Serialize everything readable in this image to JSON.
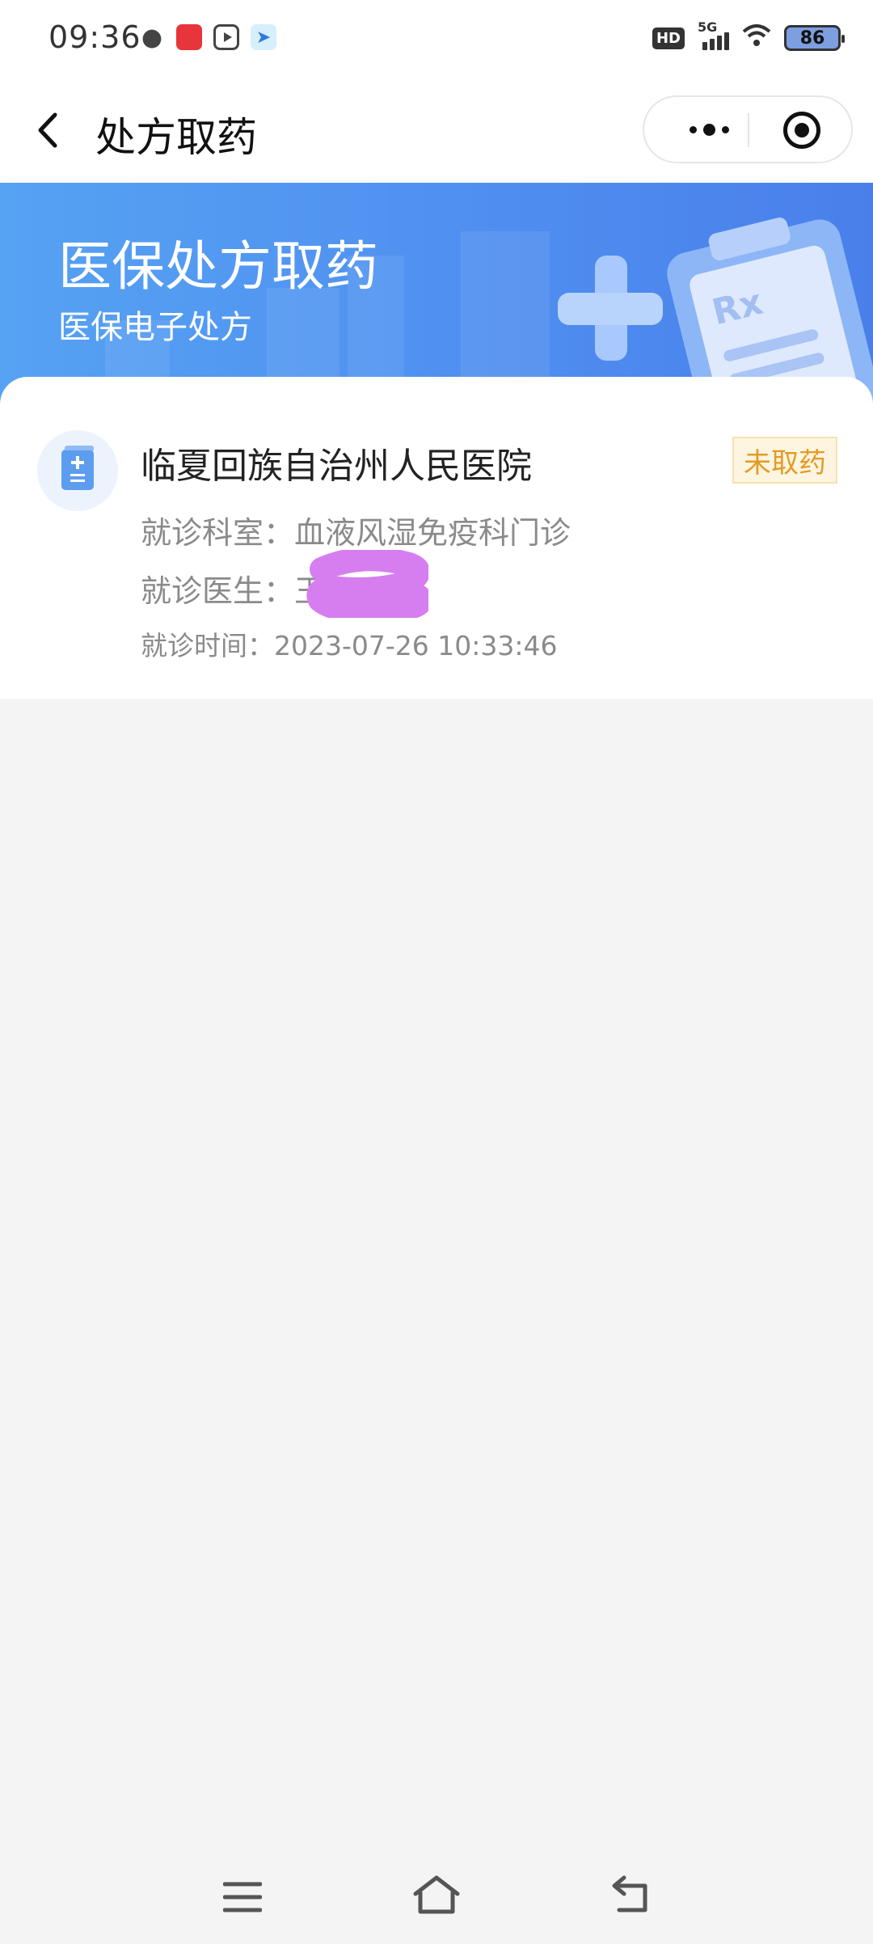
{
  "status_bar": {
    "time": "09:36",
    "hd_label": "HD",
    "network_label": "5G",
    "battery_level": "86",
    "notification_icons": [
      "wechat-icon",
      "red-app-icon",
      "video-app-icon",
      "send-app-icon"
    ]
  },
  "nav": {
    "title": "处方取药",
    "back_icon": "chevron-left-icon",
    "menu_icon": "more-dots-icon",
    "close_icon": "target-close-icon"
  },
  "banner": {
    "title": "医保处方取药",
    "subtitle": "医保电子处方",
    "illustration": "prescription-clipboard-icon"
  },
  "prescription_card": {
    "hospital": "临夏回族自治州人民医院",
    "status": "未取药",
    "dept_label": "就诊科室：",
    "dept_value": "血液风湿免疫科门诊",
    "doctor_label": "就诊医生：",
    "doctor_value": "王",
    "time_label": "就诊时间：",
    "time_value": "2023-07-26 10:33:46"
  },
  "colors": {
    "accent_blue": "#4f8ff0",
    "status_orange": "#e59a24",
    "status_bg": "#fdf5e0",
    "redaction": "#d67ef0"
  },
  "system_nav": {
    "icons": [
      "menu-icon",
      "home-icon",
      "back-icon"
    ]
  }
}
